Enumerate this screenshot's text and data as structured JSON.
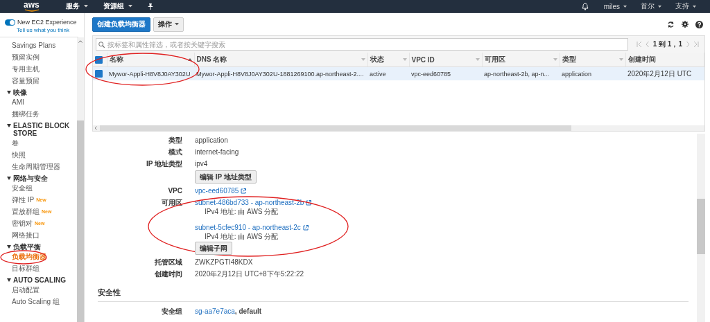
{
  "top_bar": {
    "logo": "aws",
    "menus": [
      {
        "label": "服务",
        "caret": true
      },
      {
        "label": "资源组",
        "caret": true
      }
    ],
    "right_menus": [
      {
        "label": "miles"
      },
      {
        "label": "首尔"
      },
      {
        "label": "支持"
      }
    ]
  },
  "sidebar": {
    "toggle": {
      "label": "New EC2 Experience",
      "on": true,
      "link": "Tell us what you think"
    },
    "sections": [
      {
        "items": [
          {
            "label": "Savings Plans",
            "selected": false,
            "circled": false
          },
          {
            "label": "预留实例",
            "selected": false,
            "circled": false
          },
          {
            "label": "专用主机",
            "selected": false,
            "circled": false
          },
          {
            "label": "容量预留",
            "selected": false,
            "circled": false
          }
        ]
      },
      {
        "title": "映像",
        "items": [
          {
            "label": "AMI",
            "selected": false,
            "circled": false
          },
          {
            "label": "捆绑任务",
            "selected": false,
            "circled": false
          }
        ]
      },
      {
        "title": "ELASTIC BLOCK STORE",
        "items": [
          {
            "label": "卷",
            "selected": false,
            "circled": false
          },
          {
            "label": "快照",
            "selected": false,
            "circled": false
          },
          {
            "label": "生命周期管理器",
            "selected": false,
            "circled": false
          }
        ]
      },
      {
        "title": "网络与安全",
        "items": [
          {
            "label": "安全组",
            "selected": false,
            "circled": false
          },
          {
            "label": "弹性 IP",
            "badge": "New",
            "selected": false,
            "circled": false
          },
          {
            "label": "置放群组",
            "badge": "New",
            "selected": false,
            "circled": false
          },
          {
            "label": "密钥对",
            "badge": "New",
            "selected": false,
            "circled": false
          },
          {
            "label": "网络接口",
            "selected": false,
            "circled": false
          }
        ]
      },
      {
        "title": "负载平衡",
        "items": [
          {
            "label": "负载均衡器",
            "selected": true,
            "circled": true
          },
          {
            "label": "目标群组",
            "selected": false,
            "circled": false
          }
        ]
      },
      {
        "title": "AUTO SCALING",
        "items": [
          {
            "label": "启动配置",
            "selected": false,
            "circled": false
          },
          {
            "label": "Auto Scaling 组",
            "selected": false,
            "circled": false
          }
        ]
      }
    ]
  },
  "toolbar": {
    "primary_button": "创建负载均衡器",
    "actions_button": "操作"
  },
  "search": {
    "placeholder": "按标签和属性筛选，或者按关键字搜索"
  },
  "pagination": {
    "text": "1 到 1，1"
  },
  "table": {
    "select_all_checked": true,
    "columns": [
      {
        "label": "名称",
        "sorted": true
      },
      {
        "label": "DNS 名称",
        "sorted": false
      },
      {
        "label": "状态",
        "sorted": false
      },
      {
        "label": "VPC ID",
        "sorted": false
      },
      {
        "label": "可用区",
        "sorted": false
      },
      {
        "label": "类型",
        "sorted": false
      },
      {
        "label": "创建时间"
      }
    ],
    "rows": [
      {
        "selected": true,
        "checked": true,
        "cells": [
          {
            "text": "Mywor-Appli-H8V8J0AY302U",
            "circled": true
          },
          {
            "text": "Mywor-Appli-H8V8J0AY302U-1881269100.ap-northeast-2....",
            "circled": false
          },
          {
            "text": "active",
            "circled": false
          },
          {
            "text": "vpc-eed60785",
            "circled": false
          },
          {
            "text": "ap-northeast-2b, ap-n...",
            "circled": false
          },
          {
            "text": "application",
            "circled": false
          },
          {
            "text": "2020年2月12日 UTC",
            "circled": false
          }
        ]
      }
    ]
  },
  "details": {
    "rows": [
      {
        "kind": "text",
        "label": "类型",
        "value": "application"
      },
      {
        "kind": "text",
        "label": "模式",
        "value": "internet-facing"
      },
      {
        "kind": "text",
        "label": "IP 地址类型",
        "value": "ipv4"
      },
      {
        "kind": "button",
        "value": "编辑 IP 地址类型"
      },
      {
        "kind": "link",
        "label": "VPC",
        "value": "vpc-eed60785"
      },
      {
        "kind": "zones",
        "label": "可用区",
        "circled": true,
        "zones": [
          {
            "subnet": "subnet-486bd733 - ap-northeast-2b",
            "ip": "IPv4 地址: 由 AWS 分配"
          },
          {
            "subnet": "subnet-5cfec910 - ap-northeast-2c",
            "ip": "IPv4 地址: 由 AWS 分配"
          }
        ]
      },
      {
        "kind": "button",
        "value": "编辑子网"
      },
      {
        "kind": "text",
        "label": "托管区域",
        "value": "ZWKZPGTI48KDX"
      },
      {
        "kind": "text",
        "label": "创建时间",
        "value": "2020年2月12日 UTC+8下午5:22:22"
      }
    ],
    "sections": [
      {
        "title": "安全性",
        "rows": [
          {
            "label": "安全组",
            "link": "sg-aa7e7aca",
            "suffix": ", default"
          }
        ]
      }
    ]
  }
}
